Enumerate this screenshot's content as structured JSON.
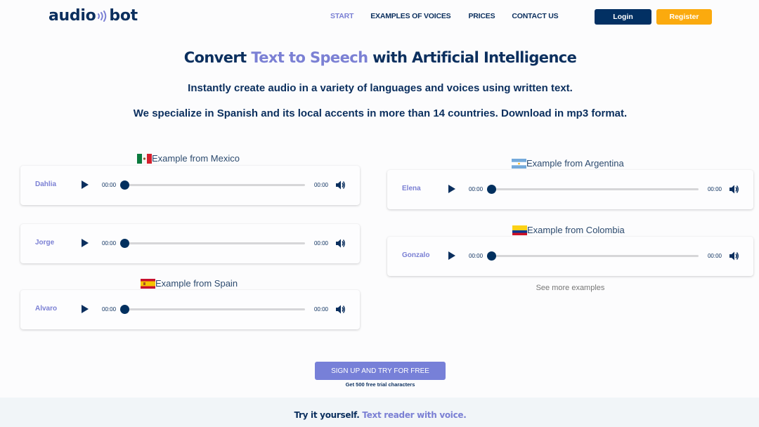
{
  "brand": {
    "logo_left": "audio",
    "logo_right": "bot",
    "icon": "sound-waves-icon"
  },
  "nav": {
    "items": [
      {
        "label": "START",
        "active": true
      },
      {
        "label": "EXAMPLES OF VOICES",
        "active": false
      },
      {
        "label": "PRICES",
        "active": false
      },
      {
        "label": "CONTACT US",
        "active": false
      }
    ],
    "login_label": "Login",
    "register_label": "Register"
  },
  "hero": {
    "title_part1": "Convert ",
    "title_accent": "Text to Speech",
    "title_part2": " with Artificial Intelligence",
    "subtitle1": "Instantly create audio in a variety of languages and voices using written text.",
    "subtitle2": "We specialize in Spanish and its local accents in more than 14 countries. Download in mp3 format."
  },
  "examples": {
    "left": [
      {
        "label": "Example from Mexico",
        "flag": "mexico-flag",
        "voices": [
          {
            "name": "Dahlia",
            "current_time": "00:00",
            "duration": "00:00",
            "progress": 0
          },
          {
            "name": "Jorge",
            "current_time": "00:00",
            "duration": "00:00",
            "progress": 0
          }
        ]
      },
      {
        "label": "Example from Spain",
        "flag": "spain-flag",
        "voices": [
          {
            "name": "Alvaro",
            "current_time": "00:00",
            "duration": "00:00",
            "progress": 0
          }
        ]
      }
    ],
    "right": [
      {
        "label": "Example from Argentina",
        "flag": "argentina-flag",
        "voices": [
          {
            "name": "Elena",
            "current_time": "00:00",
            "duration": "00:00",
            "progress": 0
          }
        ]
      },
      {
        "label": "Example from Colombia",
        "flag": "colombia-flag",
        "voices": [
          {
            "name": "Gonzalo",
            "current_time": "00:00",
            "duration": "00:00",
            "progress": 0
          }
        ]
      }
    ],
    "see_more_label": "See more examples"
  },
  "cta": {
    "button_label": "SIGN UP AND TRY FOR FREE",
    "note": "Get 500 free trial characters"
  },
  "footer_band": {
    "text_part1": "Try it yourself. ",
    "text_accent": "Text reader with voice."
  },
  "colors": {
    "primary": "#0b2f5e",
    "accent": "#7b80d4",
    "register": "#fbaa0e",
    "login": "#023063"
  }
}
